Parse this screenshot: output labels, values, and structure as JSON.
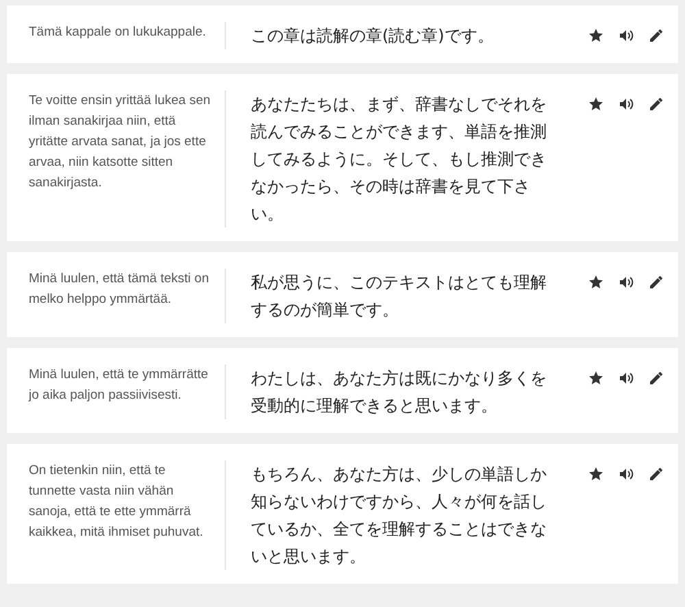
{
  "sentences": [
    {
      "finnish": "Tämä kappale on lukukappale.",
      "japanese": "この章は読解の章(読む章)です。"
    },
    {
      "finnish": "Te voitte ensin yrittää lukea sen ilman sanakirjaa niin, että yritätte arvata sanat, ja jos ette arvaa, niin katsotte sitten sanakirjasta.",
      "japanese": "あなたたちは、まず、辞書なしでそれを読んでみることができます、単語を推測してみるように。そして、もし推測できなかったら、その時は辞書を見て下さい。"
    },
    {
      "finnish": "Minä luulen, että tämä teksti on melko helppo ymmärtää.",
      "japanese": "私が思うに、このテキストはとても理解するのが簡単です。"
    },
    {
      "finnish": "Minä luulen, että te ymmärrätte jo aika paljon passiivisesti.",
      "japanese": "わたしは、あなた方は既にかなり多くを受動的に理解できると思います。"
    },
    {
      "finnish": "On tietenkin niin, että te tunnette vasta niin vähän sanoja, että te ette ymmärrä kaikkea, mitä ihmiset puhuvat.",
      "japanese": "もちろん、あなた方は、少しの単語しか知らないわけですから、人々が何を話しているか、全てを理解することはできないと思います。"
    }
  ]
}
